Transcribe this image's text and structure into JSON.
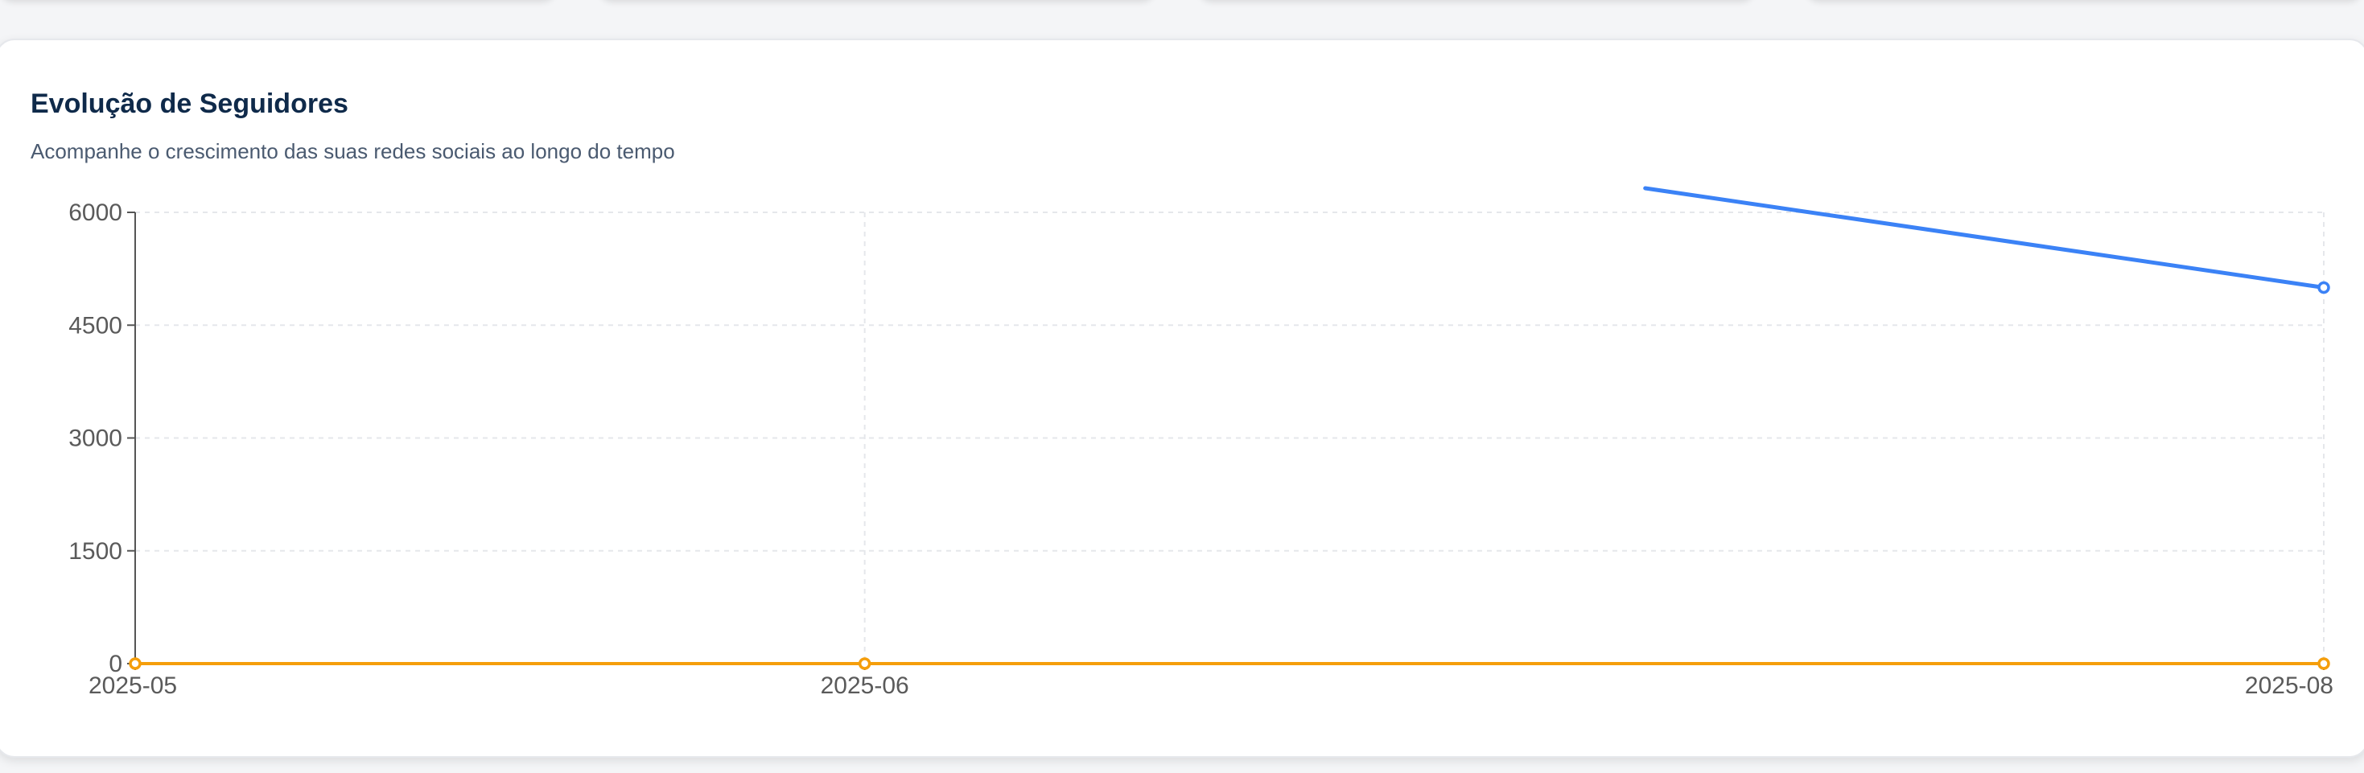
{
  "followers_chart": {
    "title": "Evolução de Seguidores",
    "subtitle": "Acompanhe o crescimento das suas redes sociais ao longo do tempo"
  },
  "chart_data": {
    "type": "line",
    "title": "Evolução de Seguidores",
    "subtitle": "Acompanhe o crescimento das suas redes sociais ao longo do tempo",
    "x": [
      "2025-05",
      "2025-06",
      "2025-08"
    ],
    "ylim": [
      0,
      6000
    ],
    "yticks": [
      0,
      1500,
      3000,
      4500,
      6000
    ],
    "grid": true,
    "series": [
      {
        "color": "#3b82f6",
        "values": [
          null,
          null,
          5000
        ],
        "partial_from_above": true
      },
      {
        "color": "#f59e0b",
        "values": [
          0,
          0,
          0
        ]
      }
    ]
  }
}
